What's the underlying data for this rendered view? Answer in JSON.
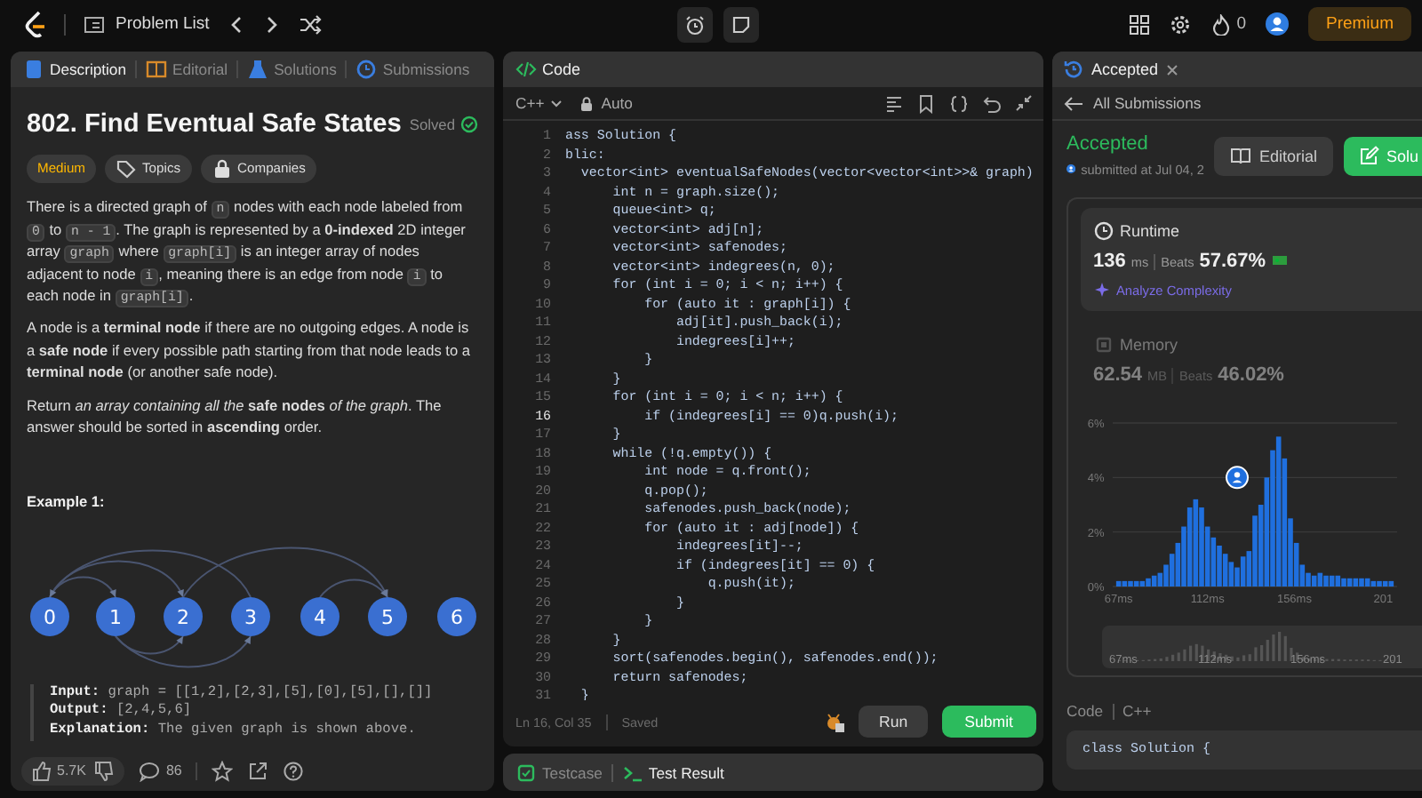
{
  "topbar": {
    "problem_list": "Problem List",
    "streak": "0",
    "premium": "Premium"
  },
  "description": {
    "tabs": [
      {
        "label": "Description",
        "selected": true,
        "kind": "doc"
      },
      {
        "label": "Editorial",
        "selected": false,
        "kind": "book"
      },
      {
        "label": "Solutions",
        "selected": false,
        "kind": "flask"
      },
      {
        "label": "Submissions",
        "selected": false,
        "kind": "clock"
      }
    ],
    "title": "802. Find Eventual Safe States",
    "status": "Solved",
    "difficulty": "Medium",
    "tags": [
      {
        "label": "Topics",
        "kind": "tag"
      },
      {
        "label": "Companies",
        "kind": "lock"
      }
    ],
    "paragraphs": [
      [
        {
          "kind": "text",
          "text": "There is a directed graph of "
        },
        {
          "kind": "code",
          "text": "n"
        },
        {
          "kind": "text",
          "text": " nodes with each node labeled from "
        },
        {
          "kind": "code",
          "text": "0"
        },
        {
          "kind": "text",
          "text": " to "
        },
        {
          "kind": "code",
          "text": "n - 1"
        },
        {
          "kind": "text",
          "text": ". The graph is represented by a **0-indexed** 2D integer array "
        },
        {
          "kind": "code",
          "text": "graph"
        },
        {
          "kind": "text",
          "text": " where "
        },
        {
          "kind": "code",
          "text": "graph[i]"
        },
        {
          "kind": "text",
          "text": " is an integer array of nodes adjacent to node "
        },
        {
          "kind": "code",
          "text": "i"
        },
        {
          "kind": "text",
          "text": ", meaning there is an edge from node "
        },
        {
          "kind": "code",
          "text": "i"
        },
        {
          "kind": "text",
          "text": " to each node in "
        },
        {
          "kind": "code",
          "text": "graph[i]"
        },
        {
          "kind": "text",
          "text": "."
        }
      ],
      [
        {
          "kind": "text",
          "text": "A node is a **terminal node** if there are no outgoing edges. A node is a **safe node** if every possible path starting from that node leads to a **terminal node** (or another safe node)."
        }
      ],
      [
        {
          "kind": "text",
          "text": "Return *an array containing all the* **safe nodes** *of the graph*. The answer should be sorted in **ascending** order."
        }
      ]
    ],
    "example_title": "Example 1:",
    "graph_nodes": [
      "0",
      "1",
      "2",
      "3",
      "4",
      "5",
      "6"
    ],
    "example_lines": [
      "**Input:** graph = [[1,2],[2,3],[5],[0],[5],[],[]]",
      "**Output:** [2,4,5,6]",
      "**Explanation:** The given graph is shown above."
    ],
    "likes": "5.7K",
    "comments": "86"
  },
  "editor": {
    "title": "Code",
    "language": "C++",
    "mode": "Auto",
    "lines": [
      {
        "n": "1",
        "text": "ass Solution {",
        "current": false
      },
      {
        "n": "2",
        "text": "blic:",
        "current": false
      },
      {
        "n": "3",
        "text": "  vector<int> eventualSafeNodes(vector<vector<int>>& graph)",
        "current": false
      },
      {
        "n": "4",
        "text": "      int n = graph.size();",
        "current": false
      },
      {
        "n": "5",
        "text": "      queue<int> q;",
        "current": false
      },
      {
        "n": "6",
        "text": "      vector<int> adj[n];",
        "current": false
      },
      {
        "n": "7",
        "text": "      vector<int> safenodes;",
        "current": false
      },
      {
        "n": "8",
        "text": "      vector<int> indegrees(n, 0);",
        "current": false
      },
      {
        "n": "9",
        "text": "      for (int i = 0; i < n; i++) {",
        "current": false
      },
      {
        "n": "10",
        "text": "          for (auto it : graph[i]) {",
        "current": false
      },
      {
        "n": "11",
        "text": "              adj[it].push_back(i);",
        "current": false
      },
      {
        "n": "12",
        "text": "              indegrees[i]++;",
        "current": false
      },
      {
        "n": "13",
        "text": "          }",
        "current": false
      },
      {
        "n": "14",
        "text": "      }",
        "current": false
      },
      {
        "n": "15",
        "text": "      for (int i = 0; i < n; i++) {",
        "current": false
      },
      {
        "n": "16",
        "text": "          if (indegrees[i] == 0)q.push(i);",
        "current": true
      },
      {
        "n": "17",
        "text": "      }",
        "current": false
      },
      {
        "n": "18",
        "text": "      while (!q.empty()) {",
        "current": false
      },
      {
        "n": "19",
        "text": "          int node = q.front();",
        "current": false
      },
      {
        "n": "20",
        "text": "          q.pop();",
        "current": false
      },
      {
        "n": "21",
        "text": "          safenodes.push_back(node);",
        "current": false
      },
      {
        "n": "22",
        "text": "          for (auto it : adj[node]) {",
        "current": false
      },
      {
        "n": "23",
        "text": "              indegrees[it]--;",
        "current": false
      },
      {
        "n": "24",
        "text": "              if (indegrees[it] == 0) {",
        "current": false
      },
      {
        "n": "25",
        "text": "                  q.push(it);",
        "current": false
      },
      {
        "n": "26",
        "text": "              }",
        "current": false
      },
      {
        "n": "27",
        "text": "          }",
        "current": false
      },
      {
        "n": "28",
        "text": "      }",
        "current": false
      },
      {
        "n": "29",
        "text": "      sort(safenodes.begin(), safenodes.end());",
        "current": false
      },
      {
        "n": "30",
        "text": "      return safenodes;",
        "current": false
      },
      {
        "n": "31",
        "text": "  }",
        "current": false
      }
    ],
    "cursor": "Ln 16, Col 35",
    "save_state": "Saved",
    "run": "Run",
    "submit": "Submit"
  },
  "console": {
    "tabs": [
      {
        "label": "Testcase",
        "selected": false,
        "kind": "check"
      },
      {
        "label": "Test Result",
        "selected": true,
        "kind": "terminal"
      }
    ]
  },
  "result": {
    "tab": "Accepted",
    "back": "All Submissions",
    "status": "Accepted",
    "submitted": "submitted at Jul 04, 2",
    "editorial": "Editorial",
    "solution": "Solu",
    "metrics": [
      {
        "kind": "runtime",
        "selected": true,
        "label": "Runtime",
        "value": "136",
        "unit": "ms",
        "beats_label": "Beats",
        "beats": "57.67%",
        "analyze": "Analyze Complexity"
      },
      {
        "kind": "memory",
        "selected": false,
        "label": "Memory",
        "value": "62.54",
        "unit": "MB",
        "beats_label": "Beats",
        "beats": "46.02%"
      }
    ],
    "chart_data": {
      "type": "bar",
      "x": [
        67,
        70,
        73,
        76,
        79,
        82,
        85,
        88,
        91,
        94,
        97,
        100,
        103,
        106,
        109,
        112,
        115,
        118,
        121,
        124,
        127,
        130,
        133,
        136,
        139,
        142,
        145,
        148,
        151,
        154,
        157,
        160,
        163,
        166,
        169,
        172,
        175,
        178,
        181,
        184,
        187,
        190,
        193,
        196,
        199,
        202,
        205
      ],
      "values": [
        0.2,
        0.2,
        0.2,
        0.2,
        0.2,
        0.3,
        0.4,
        0.5,
        0.8,
        1.2,
        1.6,
        2.2,
        2.9,
        3.2,
        2.9,
        2.2,
        1.8,
        1.5,
        1.2,
        0.9,
        0.7,
        1.1,
        1.3,
        2.6,
        3.0,
        4.0,
        5.0,
        5.5,
        4.7,
        2.5,
        1.6,
        0.8,
        0.5,
        0.4,
        0.5,
        0.4,
        0.4,
        0.4,
        0.3,
        0.3,
        0.3,
        0.3,
        0.3,
        0.2,
        0.2,
        0.2,
        0.2
      ],
      "yticks": [
        {
          "value": 0,
          "label": "0%"
        },
        {
          "value": 2,
          "label": "2%"
        },
        {
          "value": 4,
          "label": "4%"
        },
        {
          "value": 6,
          "label": "6%"
        }
      ],
      "xticks": [
        {
          "value": 67,
          "label": "67ms"
        },
        {
          "value": 112,
          "label": "112ms"
        },
        {
          "value": 156,
          "label": "156ms"
        },
        {
          "value": 201,
          "label": "201"
        }
      ],
      "xlim": [
        64,
        208
      ],
      "ylim": [
        0,
        6
      ]
    },
    "overview_labels": [
      "67ms",
      "112ms",
      "156ms",
      "201"
    ],
    "code_label": "Code",
    "code_language": "C++",
    "code_preview": "class Solution {"
  }
}
